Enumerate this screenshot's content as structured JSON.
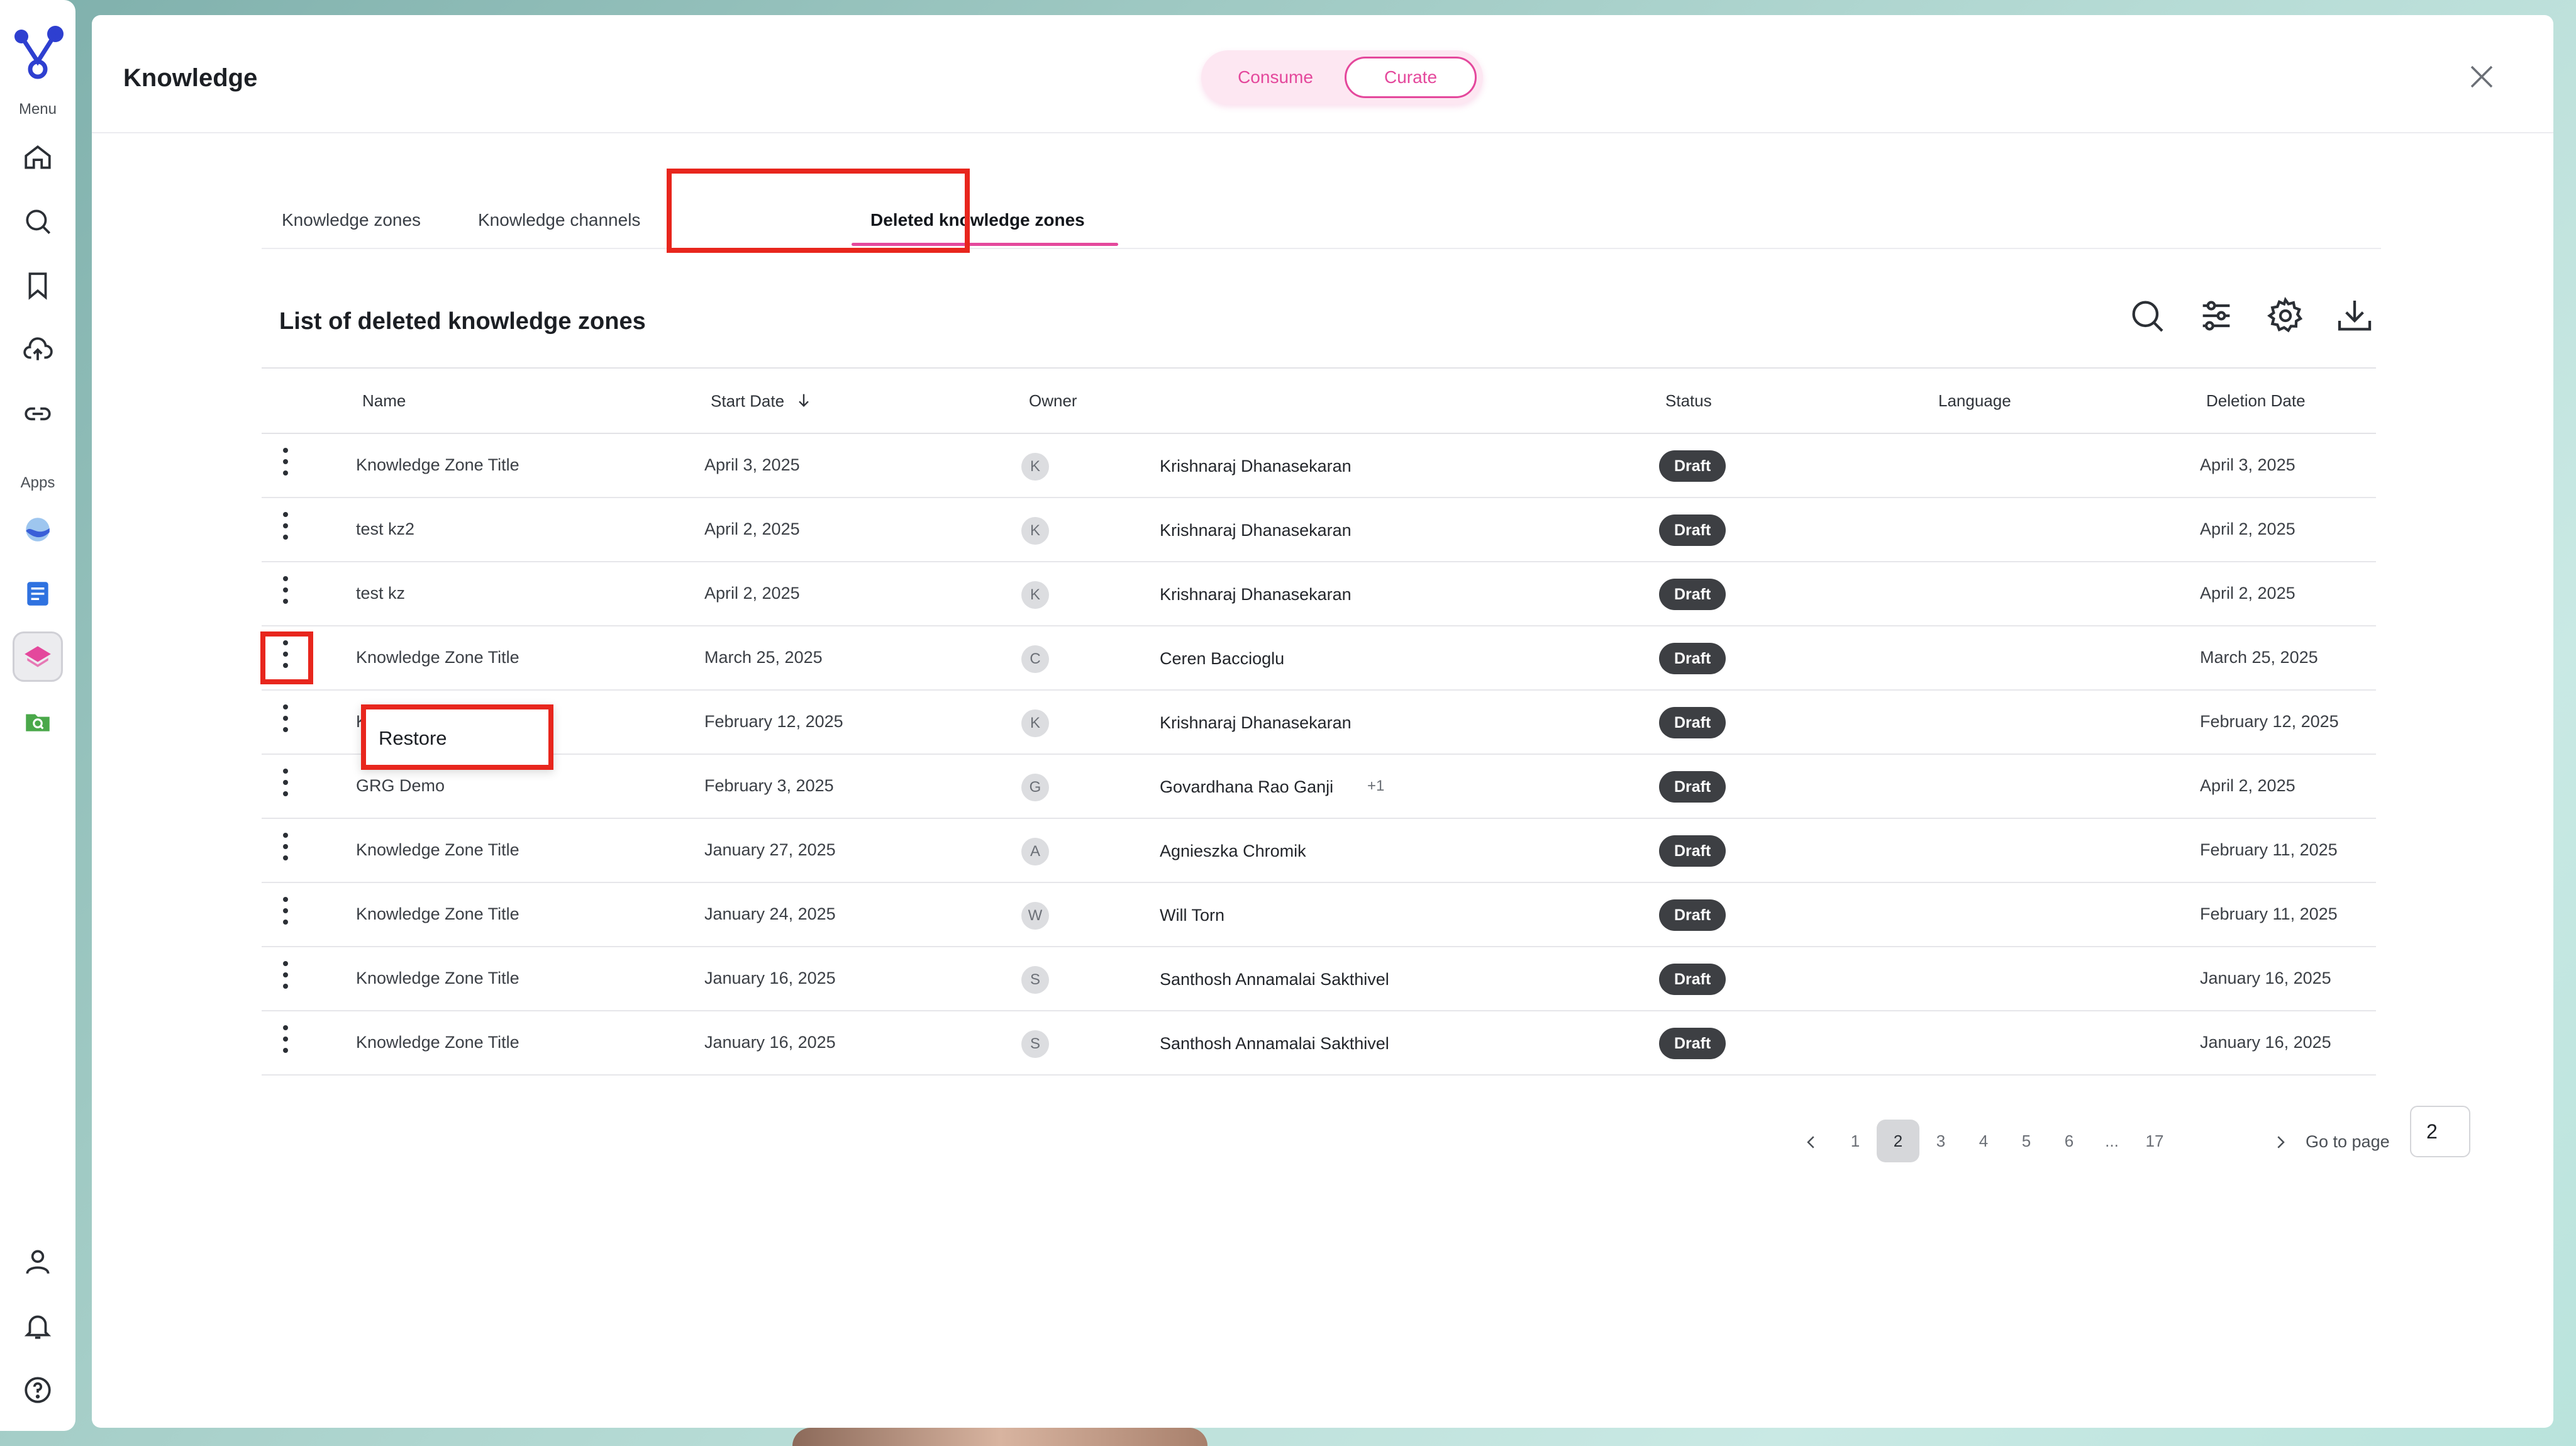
{
  "sidebar": {
    "menu_label": "Menu",
    "apps_label": "Apps",
    "items": [
      {
        "name": "home"
      },
      {
        "name": "search"
      },
      {
        "name": "bookmark"
      },
      {
        "name": "upload"
      },
      {
        "name": "link"
      }
    ],
    "apps": [
      {
        "name": "wave-app"
      },
      {
        "name": "doc-app"
      },
      {
        "name": "knowledge-app"
      },
      {
        "name": "search-folder-app"
      }
    ]
  },
  "header": {
    "title": "Knowledge",
    "mode_consume": "Consume",
    "mode_curate": "Curate"
  },
  "tabs": [
    {
      "label": "Knowledge zones"
    },
    {
      "label": "Knowledge channels"
    },
    {
      "label": "Deleted knowledge zones"
    }
  ],
  "list": {
    "title": "List of deleted knowledge zones",
    "columns": {
      "name": "Name",
      "start_date": "Start Date",
      "owner": "Owner",
      "status": "Status",
      "language": "Language",
      "deletion_date": "Deletion Date"
    },
    "rows": [
      {
        "name": "Knowledge Zone Title",
        "start": "April 3, 2025",
        "initial": "K",
        "owner": "Krishnaraj Dhanasekaran",
        "extra": "",
        "status": "Draft",
        "language": "",
        "deleted": "April 3, 2025"
      },
      {
        "name": "test kz2",
        "start": "April 2, 2025",
        "initial": "K",
        "owner": "Krishnaraj Dhanasekaran",
        "extra": "",
        "status": "Draft",
        "language": "",
        "deleted": "April 2, 2025"
      },
      {
        "name": "test kz",
        "start": "April 2, 2025",
        "initial": "K",
        "owner": "Krishnaraj Dhanasekaran",
        "extra": "",
        "status": "Draft",
        "language": "",
        "deleted": "April 2, 2025"
      },
      {
        "name": "Knowledge Zone Title",
        "start": "March 25, 2025",
        "initial": "C",
        "owner": "Ceren Baccioglu",
        "extra": "",
        "status": "Draft",
        "language": "",
        "deleted": "March 25, 2025"
      },
      {
        "name": "Knowledge Zone Title",
        "start": "February 12, 2025",
        "initial": "K",
        "owner": "Krishnaraj Dhanasekaran",
        "extra": "",
        "status": "Draft",
        "language": "",
        "deleted": "February 12, 2025"
      },
      {
        "name": "GRG Demo",
        "start": "February 3, 2025",
        "initial": "G",
        "owner": "Govardhana Rao Ganji",
        "extra": "+1",
        "status": "Draft",
        "language": "",
        "deleted": "April 2, 2025"
      },
      {
        "name": "Knowledge Zone Title",
        "start": "January 27, 2025",
        "initial": "A",
        "owner": "Agnieszka Chromik",
        "extra": "",
        "status": "Draft",
        "language": "",
        "deleted": "February 11, 2025"
      },
      {
        "name": "Knowledge Zone Title",
        "start": "January 24, 2025",
        "initial": "W",
        "owner": "Will Torn",
        "extra": "",
        "status": "Draft",
        "language": "",
        "deleted": "February 11, 2025"
      },
      {
        "name": "Knowledge Zone Title",
        "start": "January 16, 2025",
        "initial": "S",
        "owner": "Santhosh Annamalai Sakthivel",
        "extra": "",
        "status": "Draft",
        "language": "",
        "deleted": "January 16, 2025"
      },
      {
        "name": "Knowledge Zone Title",
        "start": "January 16, 2025",
        "initial": "S",
        "owner": "Santhosh Annamalai Sakthivel",
        "extra": "",
        "status": "Draft",
        "language": "",
        "deleted": "January 16, 2025"
      }
    ]
  },
  "context_menu": {
    "restore_label": "Restore"
  },
  "pagination": {
    "pages": [
      "1",
      "2",
      "3",
      "4",
      "5",
      "6",
      "...",
      "17"
    ],
    "current": "2",
    "goto_label": "Go to page",
    "goto_value": "2"
  }
}
